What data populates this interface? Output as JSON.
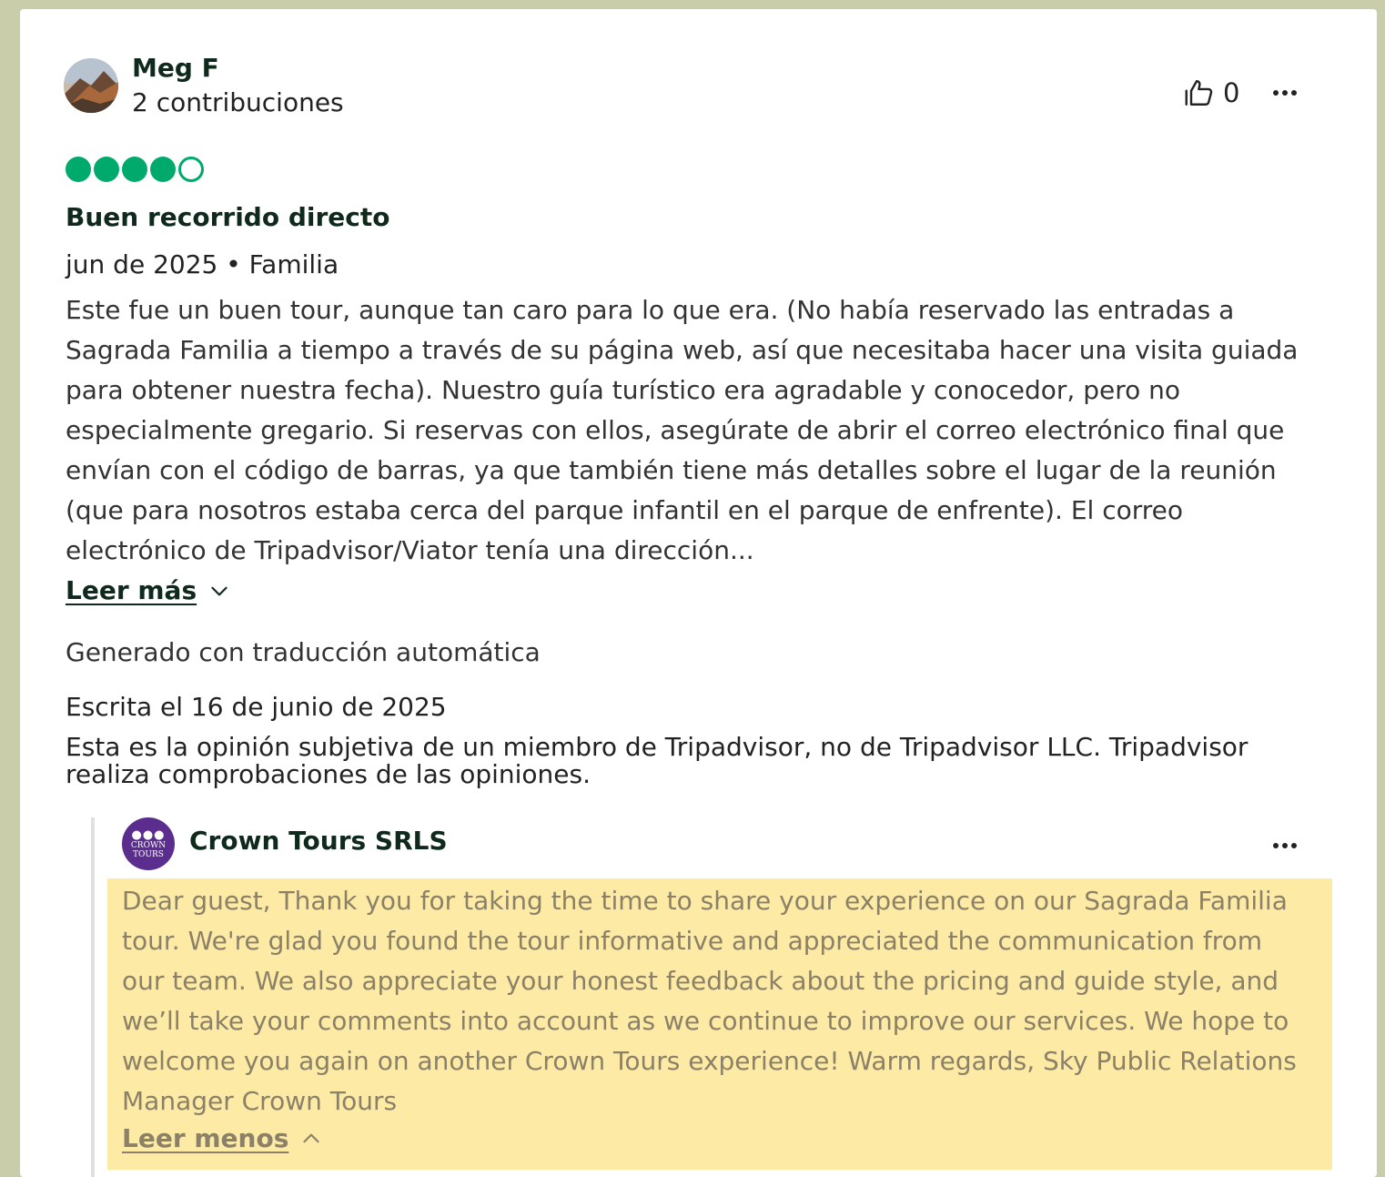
{
  "review": {
    "author": {
      "name": "Meg F",
      "contributions": "2 contribuciones",
      "avatar_icon": "user-avatar-landscape-icon"
    },
    "helpful": {
      "icon": "thumbs-up-icon",
      "count": "0"
    },
    "more_icon": "more-horizontal-icon",
    "rating": {
      "value": 4,
      "max": 5,
      "color": "#00aa6c"
    },
    "title": "Buen recorrido directo",
    "meta": "jun de 2025 • Familia",
    "text": "Este fue un buen tour, aunque tan caro para lo que era. (No había reservado las entradas a Sagrada Familia a tiempo a través de su página web, así que necesitaba hacer una visita guiada para obtener nuestra fecha). Nuestro guía turístico era agradable y conocedor, pero no especialmente gregario. Si reservas con ellos, asegúrate de abrir el correo electrónico final que envían con el código de barras, ya que también tiene más detalles sobre el lugar de la reunión (que para nosotros estaba cerca del parque infantil en el parque de enfrente). El correo electrónico de Tripadvisor/Viator tenía una dirección...",
    "read_more": "Leer más",
    "translated_note": "Generado con traducción automática",
    "written_date": "Escrita el 16 de junio de 2025",
    "disclaimer": "Esta es la opinión subjetiva de un miembro de Tripadvisor, no de Tripadvisor LLC. Tripadvisor realiza comprobaciones de las opiniones."
  },
  "reply": {
    "logo_icon": "crown-tours-logo-icon",
    "logo_text_1": "CROWN",
    "logo_text_2": "TOURS",
    "name": "Crown Tours SRLS",
    "text": "Dear guest, Thank you for taking the time to share your experience on our Sagrada Familia tour. We're glad you found the tour informative and appreciated the communication from our team. We also appreciate your honest feedback about the pricing and guide style, and we’ll take your comments into account as we continue to improve our services. We hope to welcome you again on another Crown Tours experience! Warm regards, Sky Public Relations Manager Crown Tours",
    "read_less": "Leer menos",
    "highlight_color": "#fdeaa4"
  },
  "colors": {
    "background": "#c9cdaa",
    "brand_green": "#00aa6c",
    "heading": "#0f2a1d"
  }
}
